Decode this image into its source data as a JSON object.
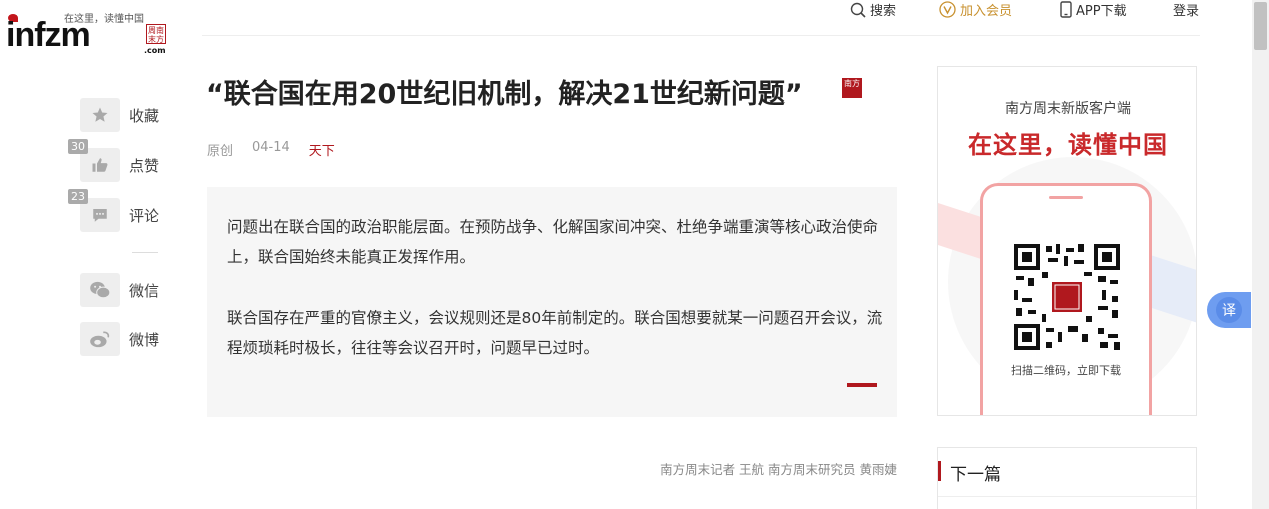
{
  "logo": {
    "brand": "infzm",
    "slogan": "在这里，读懂中国",
    "com": ".com",
    "stamp": "周南末方"
  },
  "topnav": {
    "search": "搜索",
    "vip": "加入会员",
    "app": "APP下载",
    "login": "登录"
  },
  "side": {
    "favorite": "收藏",
    "like": "点赞",
    "like_count": "30",
    "comment": "评论",
    "comment_count": "23",
    "wechat": "微信",
    "weibo": "微博"
  },
  "article": {
    "title": "“联合国在用20世纪旧机制，解决21世纪新问题”",
    "title_stamp": "南方",
    "origin": "原创",
    "date": "04-14",
    "tag": "天下",
    "summary": [
      "问题出在联合国的政治职能层面。在预防战争、化解国家间冲突、杜绝争端重演等核心政治使命上，联合国始终未能真正发挥作用。",
      "联合国存在严重的官僚主义，会议规则还是80年前制定的。联合国想要就某一问题召开会议，流程烦琐耗时极长，往往等会议召开时，问题早已过时。"
    ],
    "byline": "南方周末记者 王航 南方周末研究员 黄雨婕"
  },
  "ad": {
    "title": "南方周末新版客户端",
    "slogan": "在这里，读懂中国",
    "qr_caption": "扫描二维码，立即下载"
  },
  "next": {
    "label": "下一篇"
  },
  "translate": {
    "label": "译"
  },
  "colors": {
    "accent": "#b0181e",
    "vip": "#c8912f",
    "translate": "#6e9df0"
  }
}
